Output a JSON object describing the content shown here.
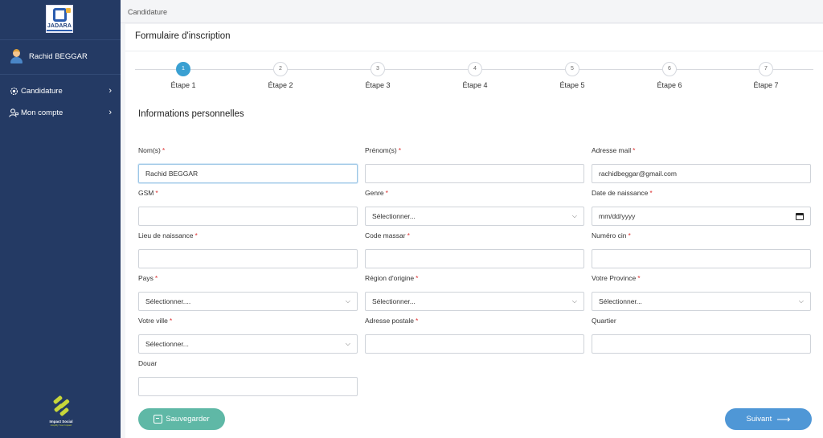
{
  "sidebar": {
    "logo_text": "JADARA",
    "user_name": "Rachid BEGGAR",
    "items": [
      {
        "label": "Candidature",
        "icon": "settings-icon"
      },
      {
        "label": "Mon compte",
        "icon": "user-account-icon"
      }
    ],
    "footer_logo": {
      "title": "Impact Social",
      "subtitle": "Amplify Your Impact"
    }
  },
  "breadcrumb": "Candidature",
  "page_title": "Formulaire d'inscription",
  "steps": [
    {
      "number": "1",
      "label": "Étape 1",
      "active": true
    },
    {
      "number": "2",
      "label": "Étape 2",
      "active": false
    },
    {
      "number": "3",
      "label": "Étape 3",
      "active": false
    },
    {
      "number": "4",
      "label": "Étape 4",
      "active": false
    },
    {
      "number": "5",
      "label": "Étape 5",
      "active": false
    },
    {
      "number": "6",
      "label": "Étape 6",
      "active": false
    },
    {
      "number": "7",
      "label": "Étape 7",
      "active": false
    }
  ],
  "section_title": "Informations personnelles",
  "fields": {
    "nom": {
      "label": "Nom(s)",
      "required": "*",
      "value": "Rachid BEGGAR"
    },
    "prenom": {
      "label": "Prénom(s)",
      "required": "*",
      "value": ""
    },
    "email": {
      "label": "Adresse mail",
      "required": "*",
      "value": "rachidbeggar@gmail.com"
    },
    "gsm": {
      "label": "GSM",
      "required": "*",
      "value": ""
    },
    "genre": {
      "label": "Genre",
      "required": "*",
      "value": "Sélectionner..."
    },
    "date_naissance": {
      "label": "Date de naissance",
      "required": "*",
      "value": "mm/dd/yyyy"
    },
    "lieu_naissance": {
      "label": "Lieu de naissance",
      "required": "*",
      "value": ""
    },
    "code_massar": {
      "label": "Code massar",
      "required": "*",
      "value": ""
    },
    "numero_cin": {
      "label": "Numéro cin",
      "required": "*",
      "value": ""
    },
    "pays": {
      "label": "Pays",
      "required": "*",
      "value": "Sélectionner...."
    },
    "region": {
      "label": "Région d'origine",
      "required": "*",
      "value": "Sélectionner..."
    },
    "province": {
      "label": "Votre Province",
      "required": "*",
      "value": "Sélectionner..."
    },
    "ville": {
      "label": "Votre ville",
      "required": "*",
      "value": "Sélectionner..."
    },
    "adresse": {
      "label": "Adresse postale",
      "required": "*",
      "value": ""
    },
    "quartier": {
      "label": "Quartier",
      "required": "",
      "value": ""
    },
    "douar": {
      "label": "Douar",
      "required": "",
      "value": ""
    }
  },
  "buttons": {
    "save": "Sauvegarder",
    "next": "Suivant"
  },
  "colors": {
    "sidebar": "#243a64",
    "active_step": "#3aa0d2",
    "save": "#5fb8a6",
    "next": "#4f97d6",
    "required": "#dd3333"
  }
}
